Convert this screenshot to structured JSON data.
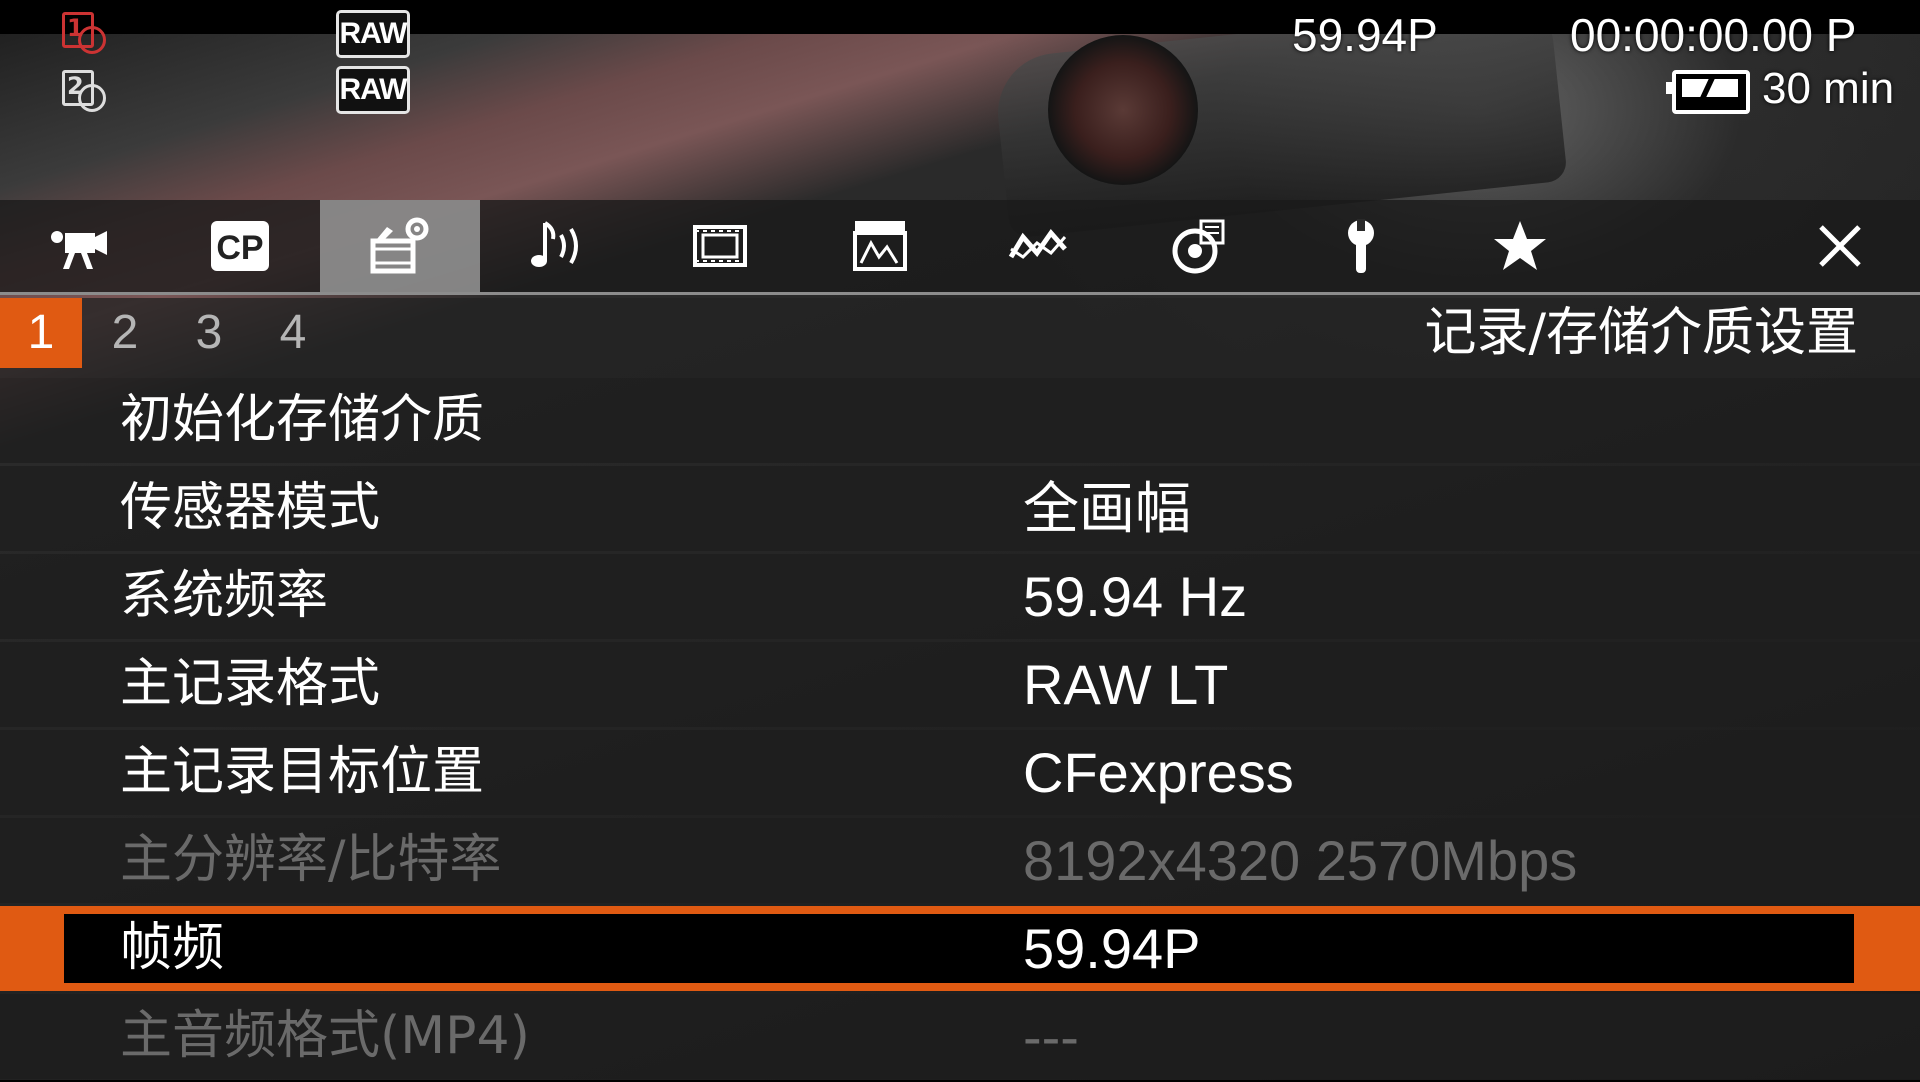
{
  "status_bar": {
    "slot1": "1",
    "slot2": "2",
    "raw_badges": [
      "RAW",
      "RAW"
    ],
    "frame_rate": "59.94P",
    "timecode": "00:00:00.00 P",
    "battery_remaining": "30 min"
  },
  "tabs": [
    {
      "icon": "camera-icon"
    },
    {
      "icon": "custom-picture-icon",
      "label": "CP"
    },
    {
      "icon": "recording-setup-icon"
    },
    {
      "icon": "audio-icon"
    },
    {
      "icon": "film-frame-icon"
    },
    {
      "icon": "monitor-assist-icon"
    },
    {
      "icon": "waveform-icon"
    },
    {
      "icon": "display-setup-icon"
    },
    {
      "icon": "wrench-icon"
    },
    {
      "icon": "star-icon"
    }
  ],
  "active_tab_index": 2,
  "pages": [
    "1",
    "2",
    "3",
    "4"
  ],
  "active_page": "1",
  "section_title": "记录/存储介质设置",
  "menu_items": [
    {
      "label": "初始化存储介质",
      "value": ""
    },
    {
      "label": "传感器模式",
      "value": "全画幅"
    },
    {
      "label": "系统频率",
      "value": "59.94 Hz"
    },
    {
      "label": "主记录格式",
      "value": "RAW LT"
    },
    {
      "label": "主记录目标位置",
      "value": "CFexpress"
    },
    {
      "label": "主分辨率/比特率",
      "value": "8192x4320 2570Mbps"
    },
    {
      "label": "帧频",
      "value": "59.94P"
    },
    {
      "label": "主音频格式(MP4)",
      "value": "---"
    }
  ],
  "colors": {
    "accent_orange": "#e05a12",
    "slot_red": "#cc3333",
    "disabled_text": "#6a6a6a"
  }
}
